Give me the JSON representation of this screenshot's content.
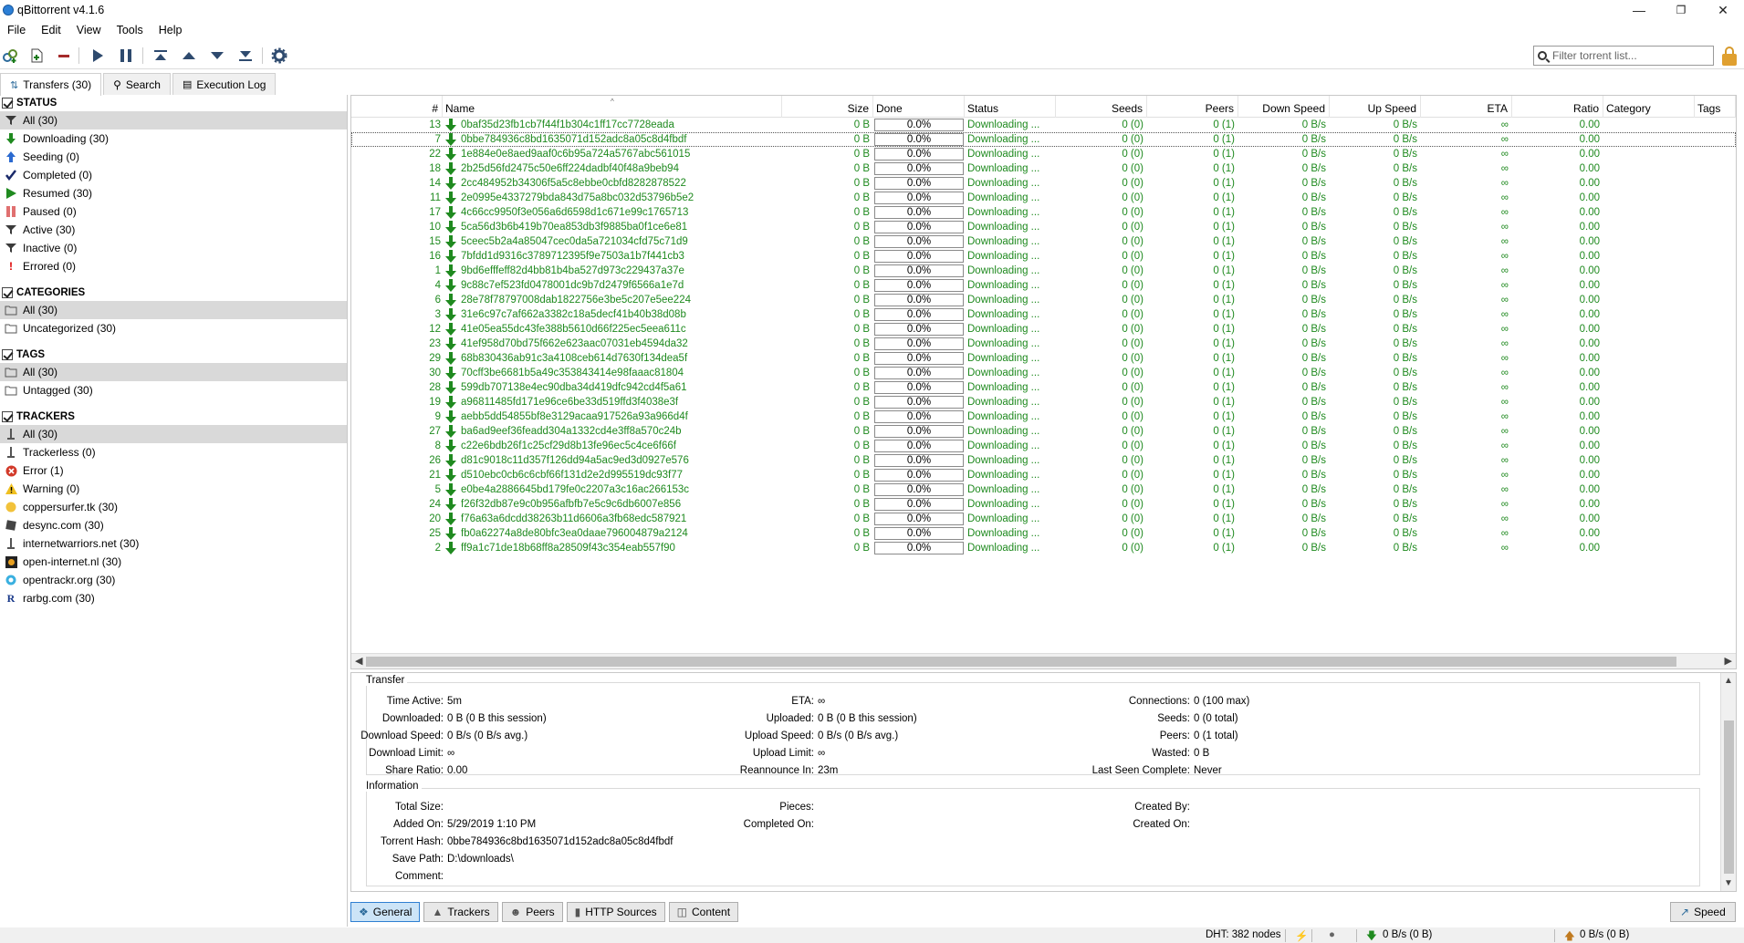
{
  "window": {
    "title": "qBittorrent v4.1.6"
  },
  "menu": [
    "File",
    "Edit",
    "View",
    "Tools",
    "Help"
  ],
  "filter": {
    "placeholder": "Filter torrent list..."
  },
  "main_tabs": [
    {
      "label": "Transfers (30)",
      "active": true
    },
    {
      "label": "Search",
      "active": false
    },
    {
      "label": "Execution Log",
      "active": false
    }
  ],
  "sidebar": {
    "status": {
      "title": "STATUS",
      "items": [
        {
          "label": "All (30)",
          "icon": "filter-icon",
          "selected": true
        },
        {
          "label": "Downloading (30)",
          "icon": "download-arrow-icon"
        },
        {
          "label": "Seeding (0)",
          "icon": "upload-arrow-icon"
        },
        {
          "label": "Completed (0)",
          "icon": "checkmark-icon"
        },
        {
          "label": "Resumed (30)",
          "icon": "play-icon"
        },
        {
          "label": "Paused (0)",
          "icon": "pause-icon"
        },
        {
          "label": "Active (30)",
          "icon": "filter-icon"
        },
        {
          "label": "Inactive (0)",
          "icon": "filter-icon"
        },
        {
          "label": "Errored (0)",
          "icon": "exclamation-icon"
        }
      ]
    },
    "categories": {
      "title": "CATEGORIES",
      "items": [
        {
          "label": "All (30)",
          "icon": "folder-icon",
          "selected": true
        },
        {
          "label": "Uncategorized (30)",
          "icon": "folder-icon"
        }
      ]
    },
    "tags": {
      "title": "TAGS",
      "items": [
        {
          "label": "All (30)",
          "icon": "folder-icon",
          "selected": true
        },
        {
          "label": "Untagged (30)",
          "icon": "folder-icon"
        }
      ]
    },
    "trackers": {
      "title": "TRACKERS",
      "items": [
        {
          "label": "All (30)",
          "icon": "network-icon",
          "selected": true
        },
        {
          "label": "Trackerless (0)",
          "icon": "network-icon"
        },
        {
          "label": "Error (1)",
          "icon": "error-icon"
        },
        {
          "label": "Warning (0)",
          "icon": "warning-icon"
        },
        {
          "label": "coppersurfer.tk (30)",
          "icon": "favicon-icon"
        },
        {
          "label": "desync.com (30)",
          "icon": "favicon-icon"
        },
        {
          "label": "internetwarriors.net (30)",
          "icon": "network-icon"
        },
        {
          "label": "open-internet.nl (30)",
          "icon": "favicon-icon"
        },
        {
          "label": "opentrackr.org (30)",
          "icon": "favicon-icon"
        },
        {
          "label": "rarbg.com (30)",
          "icon": "favicon-icon"
        }
      ]
    }
  },
  "columns": {
    "num": "#",
    "name": "Name",
    "size": "Size",
    "done": "Done",
    "status": "Status",
    "seeds": "Seeds",
    "peers": "Peers",
    "down_speed": "Down Speed",
    "up_speed": "Up Speed",
    "eta": "ETA",
    "ratio": "Ratio",
    "category": "Category",
    "tags": "Tags"
  },
  "row_defaults": {
    "size": "0 B",
    "done": "0.0%",
    "status": "Downloading ...",
    "seeds": "0 (0)",
    "peers": "0 (1)",
    "down_speed": "0 B/s",
    "up_speed": "0 B/s",
    "eta": "∞",
    "ratio": "0.00"
  },
  "torrents": [
    {
      "num": "13",
      "name": "0baf35d23fb1cb7f44f1b304c1ff17cc7728eada"
    },
    {
      "num": "7",
      "name": "0bbe784936c8bd1635071d152adc8a05c8d4fbdf",
      "focused": true
    },
    {
      "num": "22",
      "name": "1e884e0e8aed9aaf0c6b95a724a5767abc561015"
    },
    {
      "num": "18",
      "name": "2b25d56fd2475c50e6ff224dadbf40f48a9beb94"
    },
    {
      "num": "14",
      "name": "2cc484952b34306f5a5c8ebbe0cbfd8282878522"
    },
    {
      "num": "11",
      "name": "2e0995e4337279bda843d75a8bc032d53796b5e2"
    },
    {
      "num": "17",
      "name": "4c66cc9950f3e056a6d6598d1c671e99c1765713"
    },
    {
      "num": "10",
      "name": "5ca56d3b6b419b70ea853db3f9885ba0f1ce6e81"
    },
    {
      "num": "15",
      "name": "5ceec5b2a4a85047cec0da5a721034cfd75c71d9"
    },
    {
      "num": "16",
      "name": "7bfdd1d9316c3789712395f9e7503a1b7f441cb3"
    },
    {
      "num": "1",
      "name": "9bd6efffeff82d4bb81b4ba527d973c229437a37e"
    },
    {
      "num": "4",
      "name": "9c88c7ef523fd0478001dc9b7d2479f6566a1e7d"
    },
    {
      "num": "6",
      "name": "28e78f78797008dab1822756e3be5c207e5ee224"
    },
    {
      "num": "3",
      "name": "31e6c97c7af662a3382c18a5decf41b40b38d08b"
    },
    {
      "num": "12",
      "name": "41e05ea55dc43fe388b5610d66f225ec5eea611c"
    },
    {
      "num": "23",
      "name": "41ef958d70bd75f662e623aac07031eb4594da32"
    },
    {
      "num": "29",
      "name": "68b830436ab91c3a4108ceb614d7630f134dea5f"
    },
    {
      "num": "30",
      "name": "70cff3be6681b5a49c353843414e98faaac81804"
    },
    {
      "num": "28",
      "name": "599db707138e4ec90dba34d419dfc942cd4f5a61"
    },
    {
      "num": "19",
      "name": "a96811485fd171e96ce6be33d519ffd3f4038e3f"
    },
    {
      "num": "9",
      "name": "aebb5dd54855bf8e3129acaa917526a93a966d4f"
    },
    {
      "num": "27",
      "name": "ba6ad9eef36feadd304a1332cd4e3ff8a570c24b"
    },
    {
      "num": "8",
      "name": "c22e6bdb26f1c25cf29d8b13fe96ec5c4ce6f66f"
    },
    {
      "num": "26",
      "name": "d81c9018c11d357f126dd94a5ac9ed3d0927e576"
    },
    {
      "num": "21",
      "name": "d510ebc0cb6c6cbf66f131d2e2d995519dc93f77"
    },
    {
      "num": "5",
      "name": "e0be4a2886645bd179fe0c2207a3c16ac266153c"
    },
    {
      "num": "24",
      "name": "f26f32db87e9c0b956afbfb7e5c9c6db6007e856"
    },
    {
      "num": "20",
      "name": "f76a63a6dcdd38263b11d6606a3fb68edc587921"
    },
    {
      "num": "25",
      "name": "fb0a62274a8de80bfc3ea0daae796004879a2124"
    },
    {
      "num": "2",
      "name": "ff9a1c71de18b68ff8a28509f43c354eab557f90"
    }
  ],
  "details": {
    "transfer": {
      "title": "Transfer",
      "col1": [
        {
          "k": "Time Active:",
          "v": "5m"
        },
        {
          "k": "Downloaded:",
          "v": "0 B (0 B this session)"
        },
        {
          "k": "Download Speed:",
          "v": "0 B/s (0 B/s avg.)"
        },
        {
          "k": "Download Limit:",
          "v": "∞"
        },
        {
          "k": "Share Ratio:",
          "v": "0.00"
        }
      ],
      "col2": [
        {
          "k": "ETA:",
          "v": "∞"
        },
        {
          "k": "Uploaded:",
          "v": "0 B (0 B this session)"
        },
        {
          "k": "Upload Speed:",
          "v": "0 B/s (0 B/s avg.)"
        },
        {
          "k": "Upload Limit:",
          "v": "∞"
        },
        {
          "k": "Reannounce In:",
          "v": "23m"
        }
      ],
      "col3": [
        {
          "k": "Connections:",
          "v": "0 (100 max)"
        },
        {
          "k": "Seeds:",
          "v": "0 (0 total)"
        },
        {
          "k": "Peers:",
          "v": "0 (1 total)"
        },
        {
          "k": "Wasted:",
          "v": "0 B"
        },
        {
          "k": "Last Seen Complete:",
          "v": "Never"
        }
      ]
    },
    "information": {
      "title": "Information",
      "col1": [
        {
          "k": "Total Size:",
          "v": ""
        },
        {
          "k": "Added On:",
          "v": "5/29/2019 1:10 PM"
        },
        {
          "k": "Torrent Hash:",
          "v": "0bbe784936c8bd1635071d152adc8a05c8d4fbdf"
        },
        {
          "k": "Save Path:",
          "v": "D:\\downloads\\"
        },
        {
          "k": "Comment:",
          "v": ""
        }
      ],
      "col2": [
        {
          "k": "Pieces:",
          "v": ""
        },
        {
          "k": "Completed On:",
          "v": ""
        }
      ],
      "col3": [
        {
          "k": "Created By:",
          "v": ""
        },
        {
          "k": "Created On:",
          "v": ""
        }
      ]
    }
  },
  "bottom_tabs": [
    {
      "label": "General",
      "active": true
    },
    {
      "label": "Trackers"
    },
    {
      "label": "Peers"
    },
    {
      "label": "HTTP Sources"
    },
    {
      "label": "Content"
    }
  ],
  "speed_button": "Speed",
  "statusbar": {
    "dht": "DHT: 382 nodes",
    "down": "0 B/s (0 B)",
    "up": "0 B/s (0 B)"
  },
  "colors": {
    "downloading_text": "#1f8a1f",
    "selection": "#d9d9d9",
    "active_tab": "#cce4f7"
  }
}
